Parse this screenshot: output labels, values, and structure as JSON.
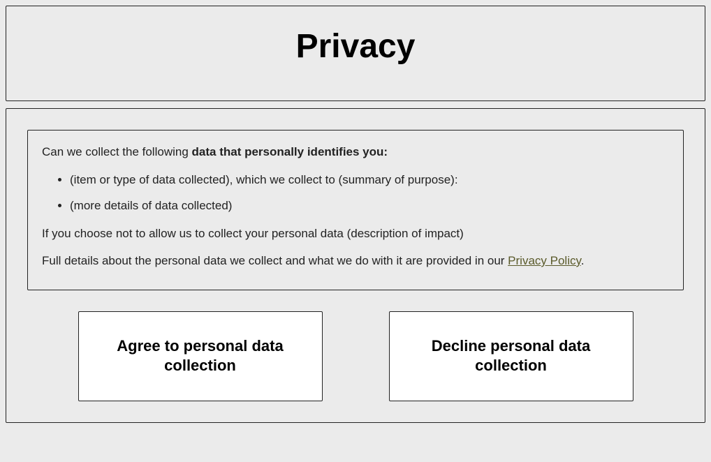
{
  "header": {
    "title": "Privacy"
  },
  "content": {
    "intro_prefix": "Can we collect the following ",
    "intro_bold": "data that personally identifies you:",
    "items": [
      "(item or type of data collected), which we collect to (summary of purpose):",
      "(more details of data collected)"
    ],
    "impact": "If you choose not to allow us to collect your personal data (description of impact)",
    "policy_prefix": "Full details about the personal data we collect and what we do with it are provided in our ",
    "policy_link": "Privacy Policy",
    "policy_suffix": "."
  },
  "buttons": {
    "agree": "Agree to personal data collection",
    "decline": "Decline personal data collection"
  }
}
